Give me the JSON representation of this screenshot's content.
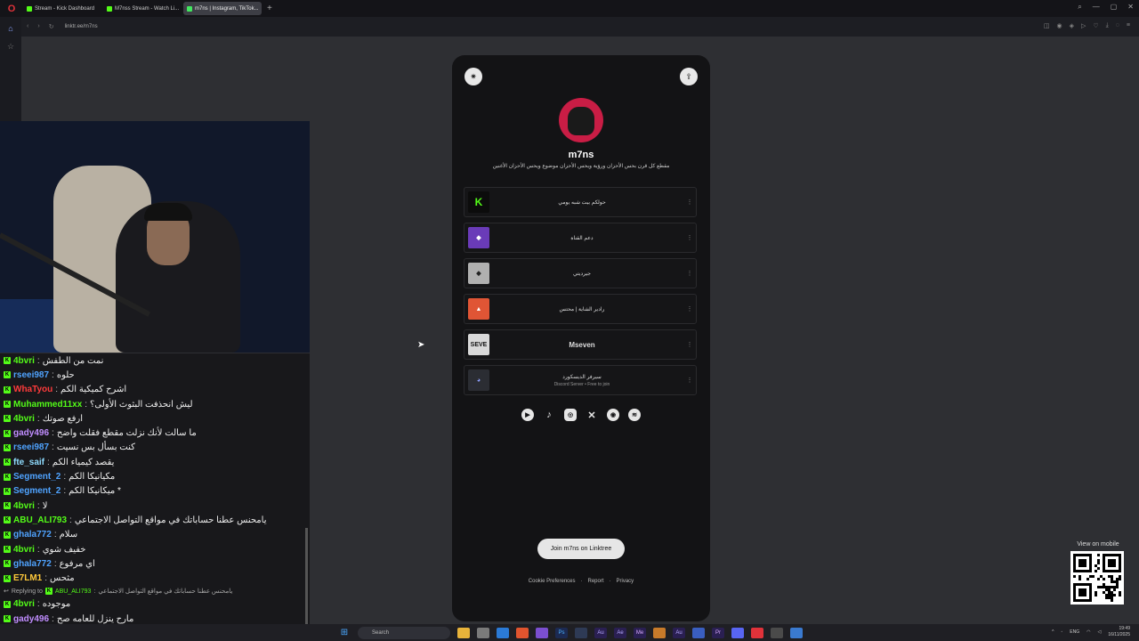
{
  "browser": {
    "tabs": [
      {
        "label": "Stream - Kick Dashboard",
        "color": "#53fc18"
      },
      {
        "label": "M7nss Stream - Watch Li...",
        "color": "#53fc18"
      },
      {
        "label": "m7ns | Instagram, TikTok...",
        "color": "#43e660"
      }
    ],
    "url": "linktr.ee/m7ns"
  },
  "linktree": {
    "name": "m7ns",
    "bio": "مقطع كل قرن بحس الأحزان ورؤية ويحس الأحزان موضوع ويحس الأحزان الأغنين",
    "links": [
      {
        "label": "حولكم بيت شبه يومي",
        "sub": "",
        "thumb": "K",
        "thumb_color": "#0c0c0c"
      },
      {
        "label": "دعم القناة",
        "sub": "",
        "thumb": "",
        "thumb_color": "#6a3bb8"
      },
      {
        "label": "جيرديتي",
        "sub": "",
        "thumb": "",
        "thumb_color": "#b0b0b0"
      },
      {
        "label": "رادير الشاية | محتس",
        "sub": "",
        "thumb": "",
        "thumb_color": "#e05535"
      },
      {
        "label": "Mseven",
        "sub": "",
        "thumb": "SEVE",
        "thumb_color": "#d9d9d9"
      },
      {
        "label": "سيرفر الديسكورد",
        "sub": "Discord Server • Free to join",
        "thumb": "",
        "thumb_color": "#2b2d33"
      }
    ],
    "socials": [
      "youtube-icon",
      "tiktok-icon",
      "instagram-icon",
      "x-icon",
      "podcast-icon",
      "spotify-icon"
    ],
    "join_label": "Join m7ns on Linktree",
    "footer": [
      "Cookie Preferences",
      "Report",
      "Privacy"
    ]
  },
  "chat": {
    "messages": [
      {
        "user": "4bvri",
        "color": "#53fc18",
        "text": "نمت من الطفش"
      },
      {
        "user": "rseei987",
        "color": "#4fa3ff",
        "text": "حلوه"
      },
      {
        "user": "WhaTyou",
        "color": "#ff3b3b",
        "text": "اشرح كميكية الكم"
      },
      {
        "user": "Muhammed11xx",
        "color": "#53fc18",
        "text": "ليش انحذفت البثوث الأولى؟"
      },
      {
        "user": "4bvri",
        "color": "#53fc18",
        "text": "ارفع صوتك"
      },
      {
        "user": "gady496",
        "color": "#c08dff",
        "text": "ما سالت لأنك نزلت مقطع فقلت واضح"
      },
      {
        "user": "rseei987",
        "color": "#4fa3ff",
        "text": "كنت بسأل بس نسيت"
      },
      {
        "user": "fte_saif",
        "color": "#8fdcff",
        "text": "يقصد كيمياء الكم"
      },
      {
        "user": "Segment_2",
        "color": "#4fa3ff",
        "text": "مكيانيكا الكم"
      },
      {
        "user": "Segment_2",
        "color": "#4fa3ff",
        "text": "ميكانيكا الكم *"
      },
      {
        "user": "4bvri",
        "color": "#53fc18",
        "text": "لا"
      },
      {
        "user": "ABU_ALI793",
        "color": "#53fc18",
        "text": "يامحنس عطنا حساباتك في مواقع التواصل الاجتماعي"
      },
      {
        "user": "ghala772",
        "color": "#4fa3ff",
        "text": "سلام"
      },
      {
        "user": "4bvri",
        "color": "#53fc18",
        "text": "خفيف شوي"
      },
      {
        "user": "ghala772",
        "color": "#4fa3ff",
        "text": "اي مرفوع"
      },
      {
        "user": "E7LM1",
        "color": "#ffc93b",
        "text": "مثحس"
      }
    ],
    "reply": {
      "prefix": "Replying to",
      "user": "ABU_ALI793",
      "text": "يامحنس عطنا حساباتك في مواقع التواصل الاجتماعي"
    },
    "after_reply": [
      {
        "user": "4bvri",
        "color": "#53fc18",
        "text": "موجوده"
      },
      {
        "user": "gady496",
        "color": "#c08dff",
        "text": "مارح ينزل للعامه صح"
      }
    ]
  },
  "qr": {
    "label": "View on mobile"
  },
  "taskbar": {
    "search": "Search",
    "lang": "ENG",
    "time": "19:49",
    "date": "16/11/2025"
  }
}
